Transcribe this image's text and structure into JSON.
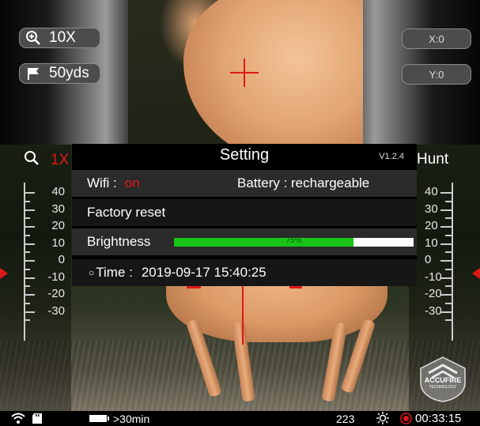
{
  "top": {
    "zoom_pill": {
      "icon": "zoom-in-icon",
      "label": "10X"
    },
    "distance_pill": {
      "icon": "flag-icon",
      "label": "50yds"
    },
    "x_pill": "X:0",
    "y_pill": "Y:0"
  },
  "header": {
    "search_icon": "search-icon",
    "zoom_text": "1X",
    "mode": "Hunt"
  },
  "scales": {
    "left": [
      "40",
      "30",
      "20",
      "10",
      "0",
      "-10",
      "-20",
      "-30"
    ],
    "right": [
      "40",
      "30",
      "20",
      "10",
      "0",
      "-10",
      "-20",
      "-30"
    ]
  },
  "settings": {
    "title": "Setting",
    "version": "V1.2.4",
    "wifi_label": "Wifi :",
    "wifi_value": "on",
    "battery_label": "Battery : rechargeable",
    "factory_reset": "Factory reset",
    "brightness_label": "Brightness",
    "brightness_value": 0.75,
    "brightness_text": "75%",
    "time_label": "Time :",
    "time_value": "2019-09-17   15:40:25"
  },
  "status_bar": {
    "wifi_icon": "wifi-icon",
    "sd_icon": "sd-card-icon",
    "battery_icon": "battery-icon",
    "battery_text": ">30min",
    "count": "223",
    "brightness_icon": "sun-icon",
    "record_icon": "record-icon",
    "timer": "00:33:15"
  },
  "logo": {
    "text1": "ACCUFIRE",
    "text2": "TECHNOLOGY"
  },
  "colors": {
    "accent_red": "#e01818",
    "bar_green": "#17c417"
  }
}
